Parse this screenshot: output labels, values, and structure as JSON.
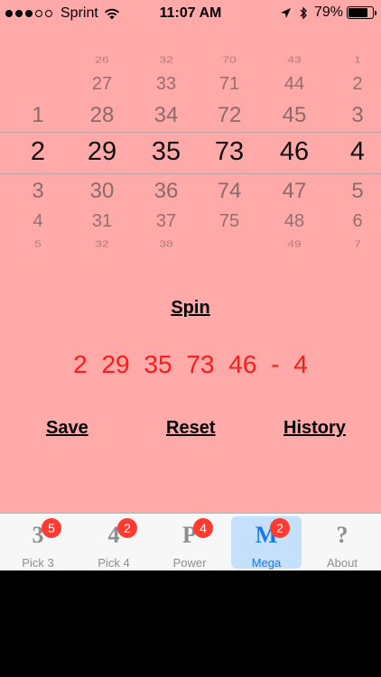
{
  "status_bar": {
    "signal_dots": [
      true,
      true,
      true,
      false,
      false
    ],
    "carrier": "Sprint",
    "time": "11:07 AM",
    "battery_percent": "79%",
    "battery_level": 0.79,
    "icons": [
      "wifi-icon",
      "location-arrow-icon",
      "bluetooth-icon",
      "battery-icon"
    ]
  },
  "picker": {
    "columns": [
      {
        "id": "b1",
        "items": [
          "",
          "",
          "1",
          "2",
          "3",
          "4",
          "5"
        ],
        "selected_index": 3
      },
      {
        "id": "b2",
        "items": [
          "26",
          "27",
          "28",
          "29",
          "30",
          "31",
          "32"
        ],
        "selected_index": 3
      },
      {
        "id": "b3",
        "items": [
          "32",
          "33",
          "34",
          "35",
          "36",
          "37",
          "38"
        ],
        "selected_index": 3
      },
      {
        "id": "b4",
        "items": [
          "70",
          "71",
          "72",
          "73",
          "74",
          "75",
          ""
        ],
        "selected_index": 3
      },
      {
        "id": "b5",
        "items": [
          "43",
          "44",
          "45",
          "46",
          "47",
          "48",
          "49"
        ],
        "selected_index": 3
      },
      {
        "id": "mega",
        "items": [
          "1",
          "2",
          "3",
          "4",
          "5",
          "6",
          "7"
        ],
        "selected_index": 3
      }
    ]
  },
  "spin_label": "Spin",
  "result": "2 29 35 73 46 - 4",
  "actions": {
    "save": "Save",
    "reset": "Reset",
    "history": "History"
  },
  "tabs": [
    {
      "glyph": "3",
      "label": "Pick 3",
      "badge": "5",
      "selected": false
    },
    {
      "glyph": "4",
      "label": "Pick 4",
      "badge": "2",
      "selected": false
    },
    {
      "glyph": "P",
      "label": "Power",
      "badge": "4",
      "selected": false
    },
    {
      "glyph": "M",
      "label": "Mega",
      "badge": "2",
      "selected": true
    },
    {
      "glyph": "?",
      "label": "About",
      "badge": "",
      "selected": false
    }
  ],
  "colors": {
    "background": "#ffa9a9",
    "result_text": "#ff1a1a",
    "tab_selected": "#1779e8",
    "badge": "#ff3b30"
  }
}
